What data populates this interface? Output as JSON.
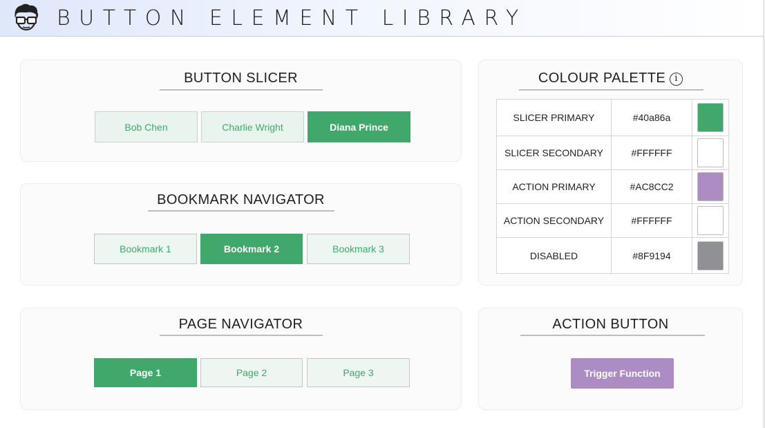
{
  "header": {
    "title": "BUTTON ELEMENT LIBRARY",
    "logo_icon": "nerd-glasses-avatar-icon"
  },
  "button_slicer": {
    "title": "BUTTON SLICER",
    "buttons": [
      {
        "label": "Bob Chen",
        "selected": false
      },
      {
        "label": "Charlie Wright",
        "selected": false
      },
      {
        "label": "Diana Prince",
        "selected": true
      }
    ]
  },
  "bookmark_navigator": {
    "title": "BOOKMARK NAVIGATOR",
    "buttons": [
      {
        "label": "Bookmark 1",
        "selected": false
      },
      {
        "label": "Bookmark 2",
        "selected": true
      },
      {
        "label": "Bookmark 3",
        "selected": false
      }
    ]
  },
  "page_navigator": {
    "title": "PAGE NAVIGATOR",
    "buttons": [
      {
        "label": "Page 1",
        "selected": true
      },
      {
        "label": "Page 2",
        "selected": false
      },
      {
        "label": "Page 3",
        "selected": false
      }
    ]
  },
  "colour_palette": {
    "title": "COLOUR PALETTE",
    "info_icon": "info-icon",
    "rows": [
      {
        "name": "SLICER PRIMARY",
        "hex": "#40a86a",
        "color": "#40a86a"
      },
      {
        "name": "SLICER SECONDARY",
        "hex": "#FFFFFF",
        "color": "#FFFFFF"
      },
      {
        "name": "ACTION PRIMARY",
        "hex": "#AC8CC2",
        "color": "#AC8CC2"
      },
      {
        "name": "ACTION SECONDARY",
        "hex": "#FFFFFF",
        "color": "#FFFFFF"
      },
      {
        "name": "DISABLED",
        "hex": "#8F9194",
        "color": "#8F9194"
      }
    ]
  },
  "action_button": {
    "title": "ACTION BUTTON",
    "button_label": "Trigger Function"
  },
  "colors": {
    "slicer_primary": "#40a86a",
    "action_primary": "#ac8cc2",
    "disabled": "#8f9194"
  }
}
